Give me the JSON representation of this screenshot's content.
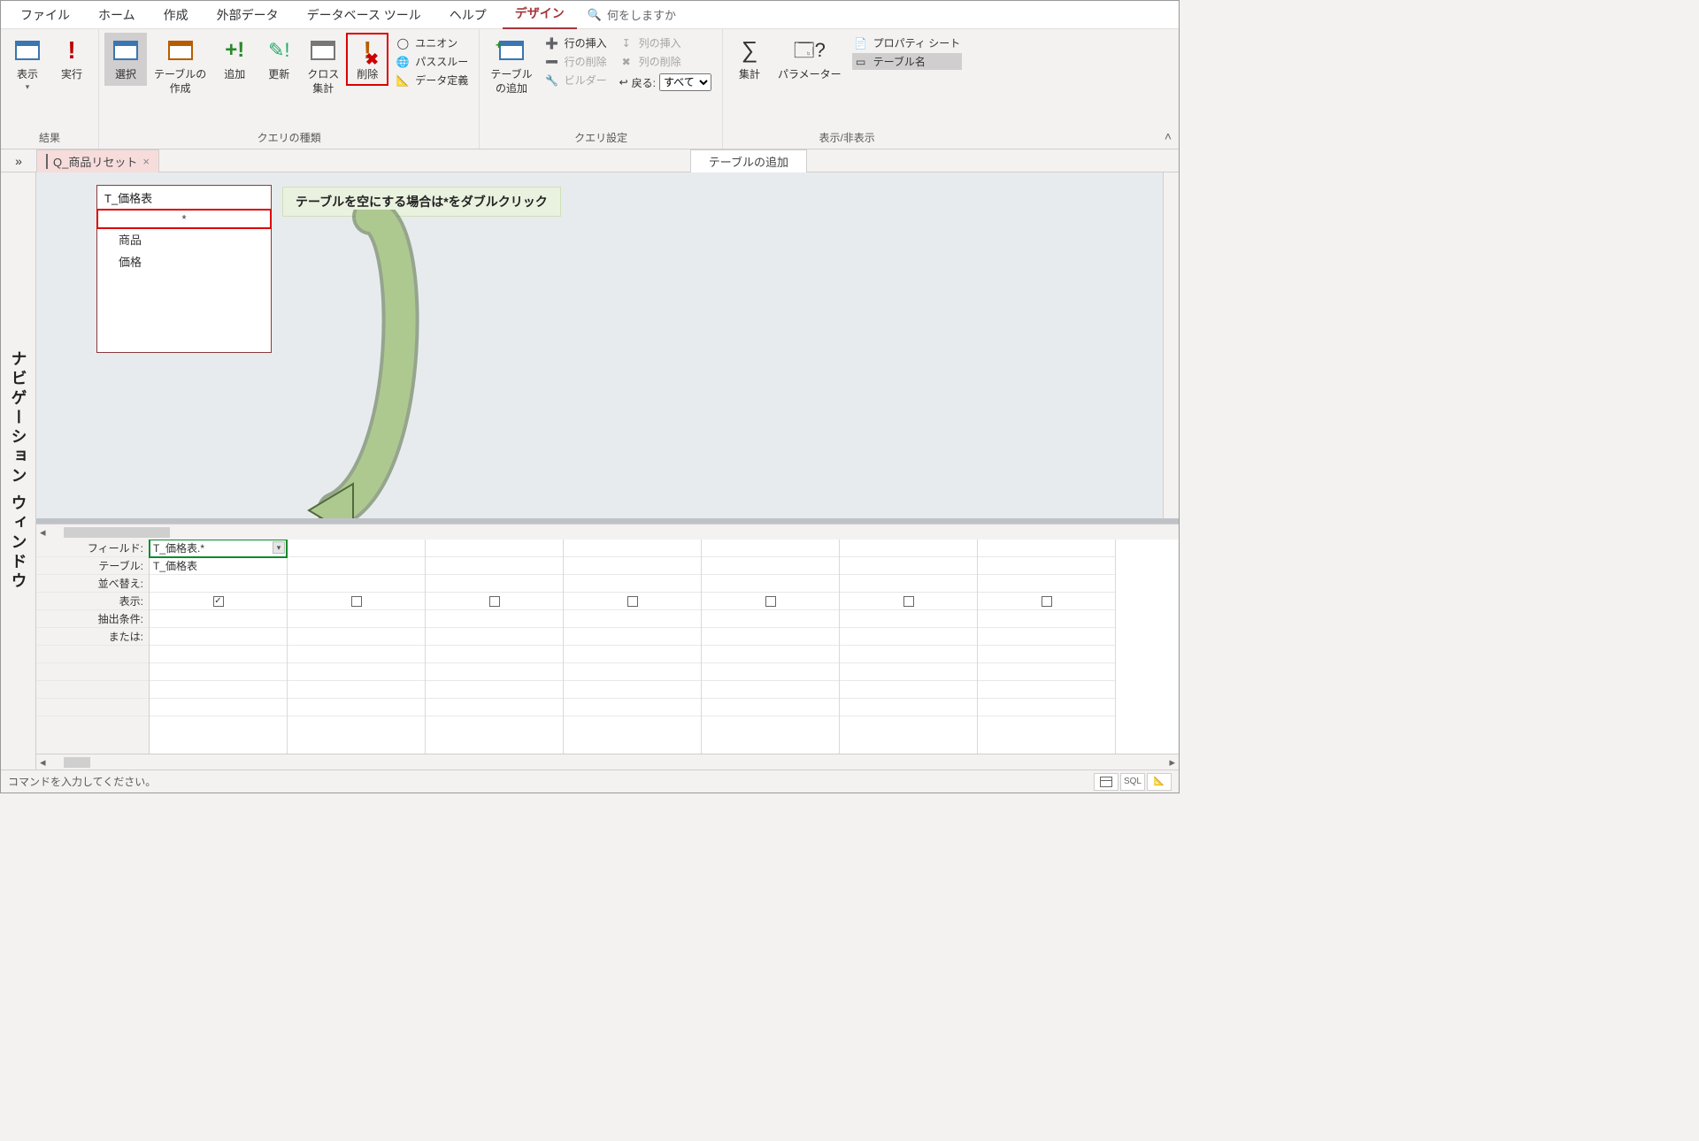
{
  "menu": {
    "items": [
      "ファイル",
      "ホーム",
      "作成",
      "外部データ",
      "データベース ツール",
      "ヘルプ",
      "デザイン"
    ],
    "active_index": 6,
    "search_placeholder": "何をしますか"
  },
  "ribbon": {
    "groups": {
      "results": {
        "label": "結果",
        "view": "表示",
        "run": "実行"
      },
      "qtype": {
        "label": "クエリの種類",
        "select": "選択",
        "maketable": "テーブルの\n作成",
        "append": "追加",
        "update": "更新",
        "crosstab": "クロス\n集計",
        "delete": "削除",
        "union": "ユニオン",
        "passthrough": "パススルー",
        "datadef": "データ定義"
      },
      "qsetup": {
        "label": "クエリ設定",
        "addtable": "テーブル\nの追加",
        "insert_row": "行の挿入",
        "delete_row": "行の削除",
        "builder": "ビルダー",
        "insert_col": "列の挿入",
        "delete_col": "列の削除",
        "return_label": "戻る:",
        "return_value": "すべて"
      },
      "showhide": {
        "label": "表示/非表示",
        "totals": "集計",
        "params": "パラメーター",
        "propsheet": "プロパティ シート",
        "tablenames": "テーブル名"
      }
    }
  },
  "doc_tab": {
    "name": "Q_商品リセット"
  },
  "side_panel": {
    "title": "テーブルの追加"
  },
  "nav_pane_label": "ナビゲーション ウィンドウ",
  "design": {
    "table": {
      "name": "T_価格表",
      "fields": [
        "*",
        "商品",
        "価格"
      ]
    },
    "callout": "テーブルを空にする場合は*をダブルクリック"
  },
  "grid": {
    "row_labels": [
      "フィールド:",
      "テーブル:",
      "並べ替え:",
      "表示:",
      "抽出条件:",
      "または:"
    ],
    "cols": [
      {
        "field": "T_価格表.*",
        "table": "T_価格表",
        "show": true
      },
      {
        "field": "",
        "table": "",
        "show": false
      },
      {
        "field": "",
        "table": "",
        "show": false
      },
      {
        "field": "",
        "table": "",
        "show": false
      },
      {
        "field": "",
        "table": "",
        "show": false
      },
      {
        "field": "",
        "table": "",
        "show": false
      },
      {
        "field": "",
        "table": "",
        "show": false
      }
    ]
  },
  "statusbar": {
    "text": "コマンドを入力してください。",
    "sql": "SQL"
  }
}
